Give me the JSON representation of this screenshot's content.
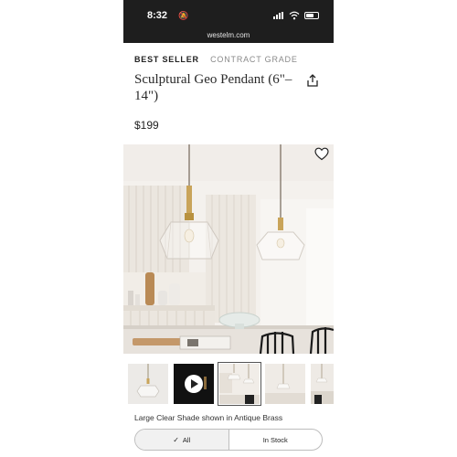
{
  "status_bar": {
    "time": "8:32",
    "bell_icon": "bell-slash-icon",
    "url": "westelm.com"
  },
  "product": {
    "badge_best_seller": "BEST SELLER",
    "badge_contract": "CONTRACT GRADE",
    "title": "Sculptural Geo Pendant (6\"–14\")",
    "price": "$199",
    "caption": "Large Clear Shade shown in Antique Brass"
  },
  "filter_toggle": {
    "all_label": "All",
    "in_stock_label": "In Stock",
    "selected": "All"
  },
  "icons": {
    "share": "share-icon",
    "favorite": "heart-icon",
    "video": "play-icon",
    "check": "check-icon"
  },
  "colors": {
    "status_bar_bg": "#1e1e1e",
    "text": "#222222",
    "muted": "#8a8a8a",
    "brass": "#c9a45a"
  },
  "thumbnails": {
    "count_visible": 5,
    "selected_index": 2
  }
}
